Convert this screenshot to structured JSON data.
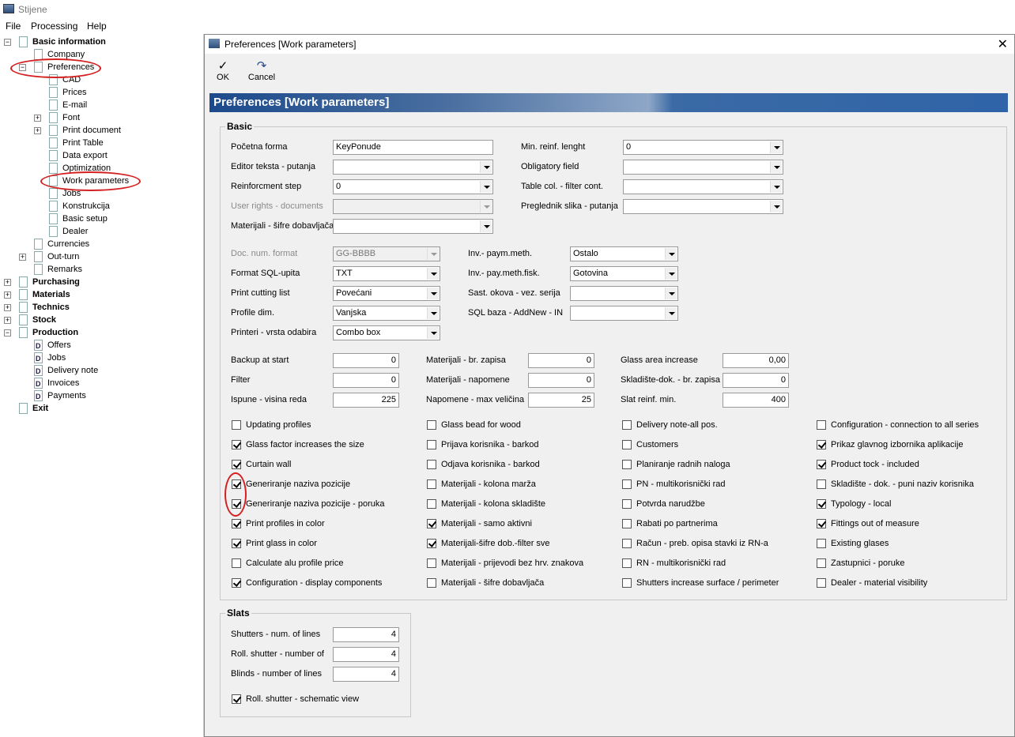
{
  "app": {
    "title": "Stijene"
  },
  "menu": {
    "file": "File",
    "processing": "Processing",
    "help": "Help"
  },
  "tree": [
    {
      "label": "Basic information",
      "bold": true,
      "level": 0,
      "expander": "minus",
      "icon": "doc"
    },
    {
      "label": "Company",
      "level": 1,
      "icon": "doc"
    },
    {
      "label": "Preferences",
      "level": 1,
      "expander": "minus",
      "icon": "doc"
    },
    {
      "label": "CAD",
      "level": 2,
      "icon": "doc"
    },
    {
      "label": "Prices",
      "level": 2,
      "icon": "doc"
    },
    {
      "label": "E-mail",
      "level": 2,
      "icon": "doc"
    },
    {
      "label": "Font",
      "level": 2,
      "expander": "plus",
      "icon": "doc"
    },
    {
      "label": "Print document",
      "level": 2,
      "expander": "plus",
      "icon": "doc"
    },
    {
      "label": "Print Table",
      "level": 2,
      "icon": "doc"
    },
    {
      "label": "Data export",
      "level": 2,
      "icon": "doc"
    },
    {
      "label": "Optimization",
      "level": 2,
      "icon": "doc"
    },
    {
      "label": "Work parameters",
      "level": 2,
      "icon": "doc"
    },
    {
      "label": "Jobs",
      "level": 2,
      "icon": "doc"
    },
    {
      "label": "Konstrukcija",
      "level": 2,
      "icon": "doc"
    },
    {
      "label": "Basic setup",
      "level": 2,
      "icon": "doc"
    },
    {
      "label": "Dealer",
      "level": 2,
      "icon": "doc"
    },
    {
      "label": "Currencies",
      "level": 1,
      "icon": "doc"
    },
    {
      "label": "Out-turn",
      "level": 1,
      "expander": "plus",
      "icon": "doc"
    },
    {
      "label": "Remarks",
      "level": 1,
      "icon": "doc"
    },
    {
      "label": "Purchasing",
      "bold": true,
      "level": 0,
      "expander": "plus",
      "icon": "doc"
    },
    {
      "label": "Materials",
      "bold": true,
      "level": 0,
      "expander": "plus",
      "icon": "doc"
    },
    {
      "label": "Technics",
      "bold": true,
      "level": 0,
      "expander": "plus",
      "icon": "doc"
    },
    {
      "label": "Stock",
      "bold": true,
      "level": 0,
      "expander": "plus",
      "icon": "doc"
    },
    {
      "label": "Production",
      "bold": true,
      "level": 0,
      "expander": "minus",
      "icon": "doc"
    },
    {
      "label": "Offers",
      "level": 1,
      "icon": "docd"
    },
    {
      "label": "Jobs",
      "level": 1,
      "icon": "docd"
    },
    {
      "label": "Delivery note",
      "level": 1,
      "icon": "docd"
    },
    {
      "label": "Invoices",
      "level": 1,
      "icon": "docd"
    },
    {
      "label": "Payments",
      "level": 1,
      "icon": "docd"
    },
    {
      "label": "Exit",
      "bold": true,
      "level": 0,
      "icon": "doc"
    }
  ],
  "dialog": {
    "title": "Preferences  [Work parameters]",
    "ok": "OK",
    "cancel": "Cancel",
    "banner": "Preferences  [Work parameters]",
    "group_basic": "Basic",
    "group_slats": "Slats"
  },
  "fields": {
    "pocetna_forma": {
      "label": "Početna forma",
      "value": "KeyPonude"
    },
    "editor_teksta": {
      "label": "Editor teksta - putanja",
      "value": ""
    },
    "reinforcment_step": {
      "label": "Reinforcment step",
      "value": "0"
    },
    "user_rights": {
      "label": "User rights - documents",
      "value": ""
    },
    "materijali_sifre": {
      "label": "Materijali - šifre dobavljača",
      "value": ""
    },
    "min_reinf": {
      "label": "Min. reinf. lenght",
      "value": "0"
    },
    "obligatory": {
      "label": "Obligatory field",
      "value": ""
    },
    "table_col": {
      "label": "Table col. - filter cont.",
      "value": ""
    },
    "preglednik": {
      "label": "Preglednik slika - putanja",
      "value": ""
    },
    "doc_num": {
      "label": "Doc. num. format",
      "value": "GG-BBBB"
    },
    "format_sql": {
      "label": "Format SQL-upita",
      "value": "TXT"
    },
    "print_cutting": {
      "label": "Print cutting list",
      "value": "Povećani"
    },
    "profile_dim": {
      "label": "Profile dim.",
      "value": "Vanjska"
    },
    "printeri": {
      "label": "Printeri - vrsta odabira",
      "value": "Combo box"
    },
    "inv_paym": {
      "label": "Inv.- paym.meth.",
      "value": "Ostalo"
    },
    "inv_pay_fisk": {
      "label": "Inv.- pay.meth.fisk.",
      "value": "Gotovina"
    },
    "sast_okova": {
      "label": "Sast. okova - vez. serija",
      "value": ""
    },
    "sql_baza": {
      "label": "SQL baza - AddNew - INSERT",
      "value": ""
    },
    "backup": {
      "label": "Backup at start",
      "value": "0"
    },
    "filter": {
      "label": "Filter",
      "value": "0"
    },
    "ispune": {
      "label": "Ispune - visina reda",
      "value": "225"
    },
    "mat_br_zapisa": {
      "label": "Materijali - br. zapisa",
      "value": "0"
    },
    "mat_napomene": {
      "label": "Materijali - napomene",
      "value": "0"
    },
    "napomene_max": {
      "label": "Napomene - max veličina",
      "value": "25"
    },
    "glass_area": {
      "label": "Glass area increase",
      "value": "0,00"
    },
    "skladiste_br": {
      "label": "Skladište-dok. - br. zapisa",
      "value": "0"
    },
    "slat_reinf": {
      "label": "Slat reinf. min.",
      "value": "400"
    },
    "shutters_lines": {
      "label": "Shutters - num. of lines",
      "value": "4"
    },
    "roll_shutter": {
      "label": "Roll. shutter - number of",
      "value": "4"
    },
    "blinds": {
      "label": "Blinds - number of lines",
      "value": "4"
    }
  },
  "checks": {
    "col1": [
      {
        "label": "Updating profiles",
        "checked": false
      },
      {
        "label": "Glass factor increases the size",
        "checked": true
      },
      {
        "label": "Curtain wall",
        "checked": true
      },
      {
        "label": "Generiranje naziva pozicije",
        "checked": true
      },
      {
        "label": "Generiranje naziva pozicije - poruka",
        "checked": true
      },
      {
        "label": "Print profiles in color",
        "checked": true
      },
      {
        "label": "Print glass in color",
        "checked": true
      },
      {
        "label": "Calculate alu profile price",
        "checked": false
      },
      {
        "label": "Configuration - display components",
        "checked": true
      }
    ],
    "col2": [
      {
        "label": "Glass bead for wood",
        "checked": false
      },
      {
        "label": "Prijava korisnika - barkod",
        "checked": false
      },
      {
        "label": "Odjava korisnika - barkod",
        "checked": false
      },
      {
        "label": "Materijali - kolona marža",
        "checked": false
      },
      {
        "label": "Materijali - kolona skladište",
        "checked": false
      },
      {
        "label": "Materijali - samo aktivni",
        "checked": true
      },
      {
        "label": "Materijali-šifre dob.-filter sve",
        "checked": true
      },
      {
        "label": "Materijali - prijevodi bez hrv. znakova",
        "checked": false
      },
      {
        "label": "Materijali - šifre dobavljača",
        "checked": false
      }
    ],
    "col3": [
      {
        "label": "Delivery note-all pos.",
        "checked": false
      },
      {
        "label": "Customers",
        "checked": false
      },
      {
        "label": "Planiranje radnih naloga",
        "checked": false
      },
      {
        "label": "PN - multikorisnički rad",
        "checked": false
      },
      {
        "label": "Potvrda narudžbe",
        "checked": false
      },
      {
        "label": "Rabati po partnerima",
        "checked": false
      },
      {
        "label": "Račun - preb. opisa stavki iz RN-a",
        "checked": false
      },
      {
        "label": "RN - multikorisnički rad",
        "checked": false
      },
      {
        "label": "Shutters increase surface / perimeter",
        "checked": false
      }
    ],
    "col4": [
      {
        "label": "Configuration - connection to all series",
        "checked": false
      },
      {
        "label": "Prikaz glavnog izbornika aplikacije",
        "checked": true
      },
      {
        "label": "Product tock - included",
        "checked": true
      },
      {
        "label": "Skladište - dok. - puni naziv korisnika",
        "checked": false
      },
      {
        "label": "Typology - local",
        "checked": true
      },
      {
        "label": "Fittings out of measure",
        "checked": true
      },
      {
        "label": "Existing glases",
        "checked": false
      },
      {
        "label": "Zastupnici - poruke",
        "checked": false
      },
      {
        "label": "Dealer - material visibility",
        "checked": false
      }
    ],
    "roll_schematic": {
      "label": "Roll. shutter - schematic view",
      "checked": true
    }
  },
  "icons": {
    "ok": "checkmark-icon",
    "cancel": "undo-icon",
    "close": "close-icon"
  },
  "colors": {
    "banner": "#2f64a8",
    "annotation": "#d42020"
  }
}
